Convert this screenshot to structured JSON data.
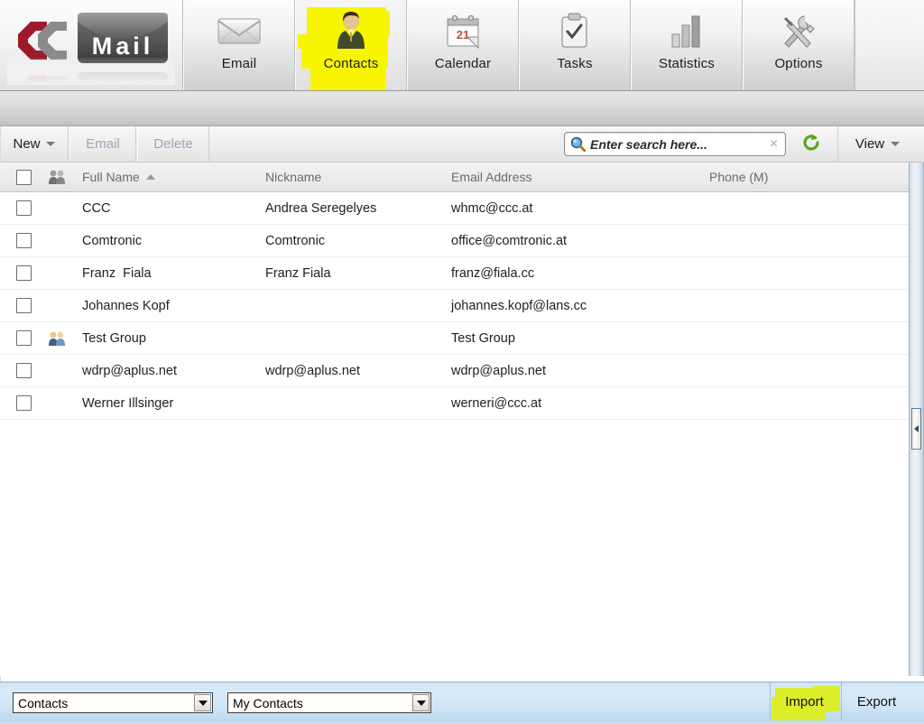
{
  "app": {
    "logo_text": "Mail",
    "logo_colors": {
      "mark_red": "#9b1b29",
      "mark_gray": "#8b8b8b",
      "envelope": "#555555"
    }
  },
  "tabs": [
    {
      "label": "Email",
      "icon": "envelope-icon",
      "active": false,
      "highlighted": false
    },
    {
      "label": "Contacts",
      "icon": "person-contact-icon",
      "active": true,
      "highlighted": true
    },
    {
      "label": "Calendar",
      "icon": "calendar-icon",
      "active": false,
      "highlighted": false
    },
    {
      "label": "Tasks",
      "icon": "clipboard-check-icon",
      "active": false,
      "highlighted": false
    },
    {
      "label": "Statistics",
      "icon": "bar-chart-icon",
      "active": false,
      "highlighted": false
    },
    {
      "label": "Options",
      "icon": "tools-icon",
      "active": false,
      "highlighted": false
    }
  ],
  "toolbar": {
    "new_label": "New",
    "email_label": "Email",
    "delete_label": "Delete",
    "view_label": "View",
    "refresh_icon": "refresh-icon",
    "search": {
      "placeholder": "Enter search here...",
      "value": "",
      "icon": "search-icon",
      "clear_icon": "×"
    }
  },
  "list": {
    "columns": [
      {
        "key": "full_name",
        "label": "Full Name",
        "sort": "asc"
      },
      {
        "key": "nickname",
        "label": "Nickname",
        "sort": ""
      },
      {
        "key": "email",
        "label": "Email Address",
        "sort": ""
      },
      {
        "key": "phone",
        "label": "Phone (M)",
        "sort": ""
      }
    ],
    "header_group_icon": "group-icon",
    "header_checkbox_checked": false,
    "rows": [
      {
        "checked": false,
        "group": false,
        "full_name": "CCC",
        "nickname": "Andrea Seregelyes",
        "email": "whmc@ccc.at",
        "phone": ""
      },
      {
        "checked": false,
        "group": false,
        "full_name": "Comtronic",
        "nickname": "Comtronic",
        "email": "office@comtronic.at",
        "phone": ""
      },
      {
        "checked": false,
        "group": false,
        "full_name": "Franz  Fiala",
        "nickname": "Franz Fiala",
        "email": "franz@fiala.cc",
        "phone": ""
      },
      {
        "checked": false,
        "group": false,
        "full_name": "Johannes Kopf",
        "nickname": "",
        "email": "johannes.kopf@lans.cc",
        "phone": ""
      },
      {
        "checked": false,
        "group": true,
        "full_name": "Test Group",
        "nickname": "",
        "email": "Test Group",
        "phone": ""
      },
      {
        "checked": false,
        "group": false,
        "full_name": "wdrp@aplus.net",
        "nickname": "wdrp@aplus.net",
        "email": "wdrp@aplus.net",
        "phone": ""
      },
      {
        "checked": false,
        "group": false,
        "full_name": "Werner Illsinger",
        "nickname": "",
        "email": "werneri@ccc.at",
        "phone": ""
      }
    ]
  },
  "splitter": {
    "handle_icon": "collapse-left-arrow-icon"
  },
  "bottom": {
    "folder_type_select": {
      "value": "Contacts",
      "options": [
        "Contacts"
      ]
    },
    "folder_select": {
      "value": "My Contacts",
      "options": [
        "My Contacts"
      ]
    },
    "import_label": "Import",
    "export_label": "Export"
  },
  "annotations": {
    "contacts_highlight_color": "#f8f500",
    "import_highlight_color": "#dced2a"
  }
}
